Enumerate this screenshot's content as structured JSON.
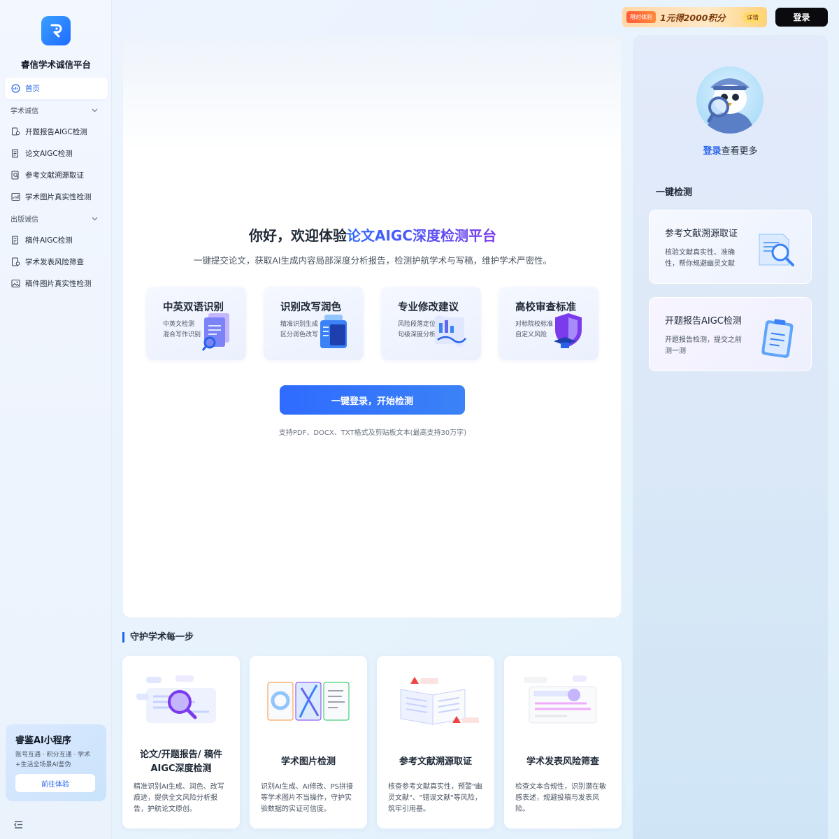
{
  "sidebar": {
    "brand": "睿信学术诚信平台",
    "home": "首页",
    "group1": "学术诚信",
    "group1_items": [
      "开题报告AIGC检测",
      "论文AIGC检测",
      "参考文献溯源取证",
      "学术图片真实性检测"
    ],
    "group2": "出版诚信",
    "group2_items": [
      "稿件AIGC检测",
      "学术发表风险筛查",
      "稿件图片真实性检测"
    ],
    "mini": {
      "title": "睿鉴AI小程序",
      "desc": "账号互通 · 积分互通 · 学术+生活全场景AI鉴伪",
      "button": "前往体验"
    }
  },
  "header": {
    "promo_tag": "限时体验",
    "promo_text": "1元得2000积分",
    "promo_detail": "详情",
    "login": "登录"
  },
  "hero": {
    "title_prefix": "你好，欢迎体验",
    "title_highlight": "论文AIGC深度检测平台",
    "subtitle": "一键提交论文，获取AI生成内容局部深度分析报告，检测护航学术与写稿，维护学术严密性。",
    "features": [
      {
        "title": "中英双语识别",
        "line1": "中英文检测",
        "line2": "混合写作识别"
      },
      {
        "title": "识别改写润色",
        "line1": "精准识别生成",
        "line2": "区分润色改写"
      },
      {
        "title": "专业修改建议",
        "line1": "风险段落定位",
        "line2": "句级深度分析"
      },
      {
        "title": "高校审查标准",
        "line1": "对标院校标准",
        "line2": "自定义风险"
      }
    ],
    "button": "一键登录，开始检测",
    "support": "支持PDF、DOCX、TXT格式及剪贴板文本(最高支持30万字)"
  },
  "right": {
    "login_link": "登录",
    "login_rest": "查看更多",
    "quick_title": "一键检测",
    "cards": [
      {
        "title": "参考文献溯源取证",
        "desc": "核验文献真实性、准确性，帮你规避幽灵文献"
      },
      {
        "title": "开题报告AIGC检测",
        "desc": "开题报告检测，提交之前测一测"
      }
    ]
  },
  "bottom": {
    "section_title": "守护学术每一步",
    "cards": [
      {
        "title": "论文/开题报告/ 稿件AIGC深度检测",
        "desc": "精准识别AI生成、润色、改写痕迹，提供全文风险分析报告，护航论文原创。"
      },
      {
        "title": "学术图片检测",
        "desc": "识别AI生成、AI修改、PS拼接等学术图片不当操作，守护实验数据的实证可信度。"
      },
      {
        "title": "参考文献溯源取证",
        "desc": "核查参考文献真实性，预警\"幽灵文献\"、\"错误文献\"等风险，筑牢引用基。"
      },
      {
        "title": "学术发表风险筛查",
        "desc": "检查文本合规性，识别潜在敏感表述，规避投稿与发表风险。"
      }
    ]
  },
  "colors": {
    "accent": "#2563eb",
    "dark_button": "#0b0b0f"
  }
}
